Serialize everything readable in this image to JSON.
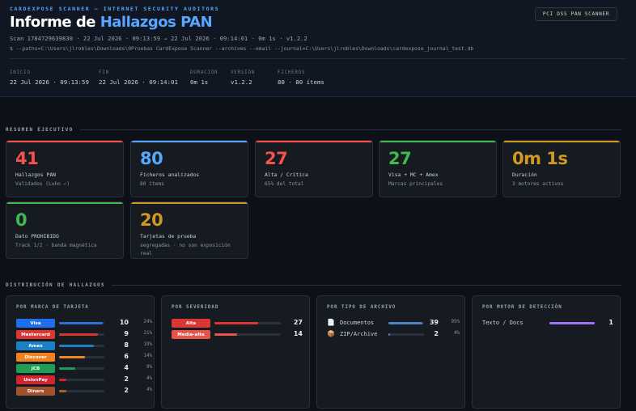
{
  "header": {
    "brand": "CARDEXPOSE SCANNER — INTERNET SECURITY AUDITORS",
    "title_prefix": "Informe de ",
    "title_accent": "Hallazgos PAN",
    "scan_line": "Scan 1784729639830  ·  22 Jul 2026 · 09:13:59 → 22 Jul 2026 · 09:14:01  ·  0m 1s  ·  v1.2.2",
    "command": "$ --paths=C:\\Users\\jlrobles\\Downloads\\0Pruebas CardExpose Scanner --archives --email --journal=C:\\Users\\jlrobles\\Downloads\\cardexpose_journal_test.db",
    "badge": "PCI DSS PAN SCANNER",
    "meta": [
      {
        "key": "INICIO",
        "value": "22 Jul 2026 · 09:13:59"
      },
      {
        "key": "FIN",
        "value": "22 Jul 2026 · 09:14:01"
      },
      {
        "key": "DURACIÓN",
        "value": "0m 1s"
      },
      {
        "key": "VERSIÓN",
        "value": "v1.2.2"
      },
      {
        "key": "FICHEROS",
        "value": "80 · 80 ítems"
      }
    ]
  },
  "sections": {
    "summary": "RESUMEN EJECUTIVO",
    "distribution": "DISTRIBUCIÓN DE HALLAZGOS"
  },
  "kpis": [
    {
      "value": "41",
      "label": "Hallazgos PAN",
      "sub": "Validados (Luhn ✓)",
      "color": "#f85149",
      "bar": "#f85149"
    },
    {
      "value": "80",
      "label": "Ficheros analizados",
      "sub": "80 ítems",
      "color": "#58a6ff",
      "bar": "#58a6ff"
    },
    {
      "value": "27",
      "label": "Alta / Crítica",
      "sub": "65% del total",
      "color": "#f85149",
      "bar": "#f85149"
    },
    {
      "value": "27",
      "label": "Visa + MC + Amex",
      "sub": "Marcas principales",
      "color": "#3fb950",
      "bar": "#3fb950"
    },
    {
      "value": "0m 1s",
      "label": "Duración",
      "sub": "3 motores activos",
      "color": "#d29922",
      "bar": "#d29922"
    },
    {
      "value": "0",
      "label": "Dato PROHIBIDO",
      "sub": "Track 1/2 · banda magnética",
      "color": "#3fb950",
      "bar": "#3fb950"
    },
    {
      "value": "20",
      "label": "Tarjetas de prueba",
      "sub": "segregadas · no son exposición real",
      "color": "#d29922",
      "bar": "#d29922"
    }
  ],
  "panels": {
    "brand": {
      "title": "POR MARCA DE TARJETA",
      "rows": [
        {
          "name": "Visa",
          "count": "10",
          "pct": "24%",
          "frac": 0.24,
          "color": "#1f6feb",
          "bar": "#2f6fd8"
        },
        {
          "name": "Mastercard",
          "count": "9",
          "pct": "21%",
          "frac": 0.21,
          "color": "#da3633",
          "bar": "#da3633"
        },
        {
          "name": "Amex",
          "count": "8",
          "pct": "19%",
          "frac": 0.19,
          "color": "#1b80c4",
          "bar": "#1b80c4"
        },
        {
          "name": "Discover",
          "count": "6",
          "pct": "14%",
          "frac": 0.14,
          "color": "#f0821f",
          "bar": "#f0821f"
        },
        {
          "name": "JCB",
          "count": "4",
          "pct": "9%",
          "frac": 0.09,
          "color": "#1f9d55",
          "bar": "#1f9d55"
        },
        {
          "name": "UnionPay",
          "count": "2",
          "pct": "4%",
          "frac": 0.04,
          "color": "#d1242f",
          "bar": "#d1242f"
        },
        {
          "name": "Diners",
          "count": "2",
          "pct": "4%",
          "frac": 0.04,
          "color": "#a0522d",
          "bar": "#b35c24"
        }
      ]
    },
    "severity": {
      "title": "POR SEVERIDAD",
      "rows": [
        {
          "name": "Alta",
          "count": "27",
          "frac": 0.66,
          "color": "#da3633",
          "bar": "#da3633"
        },
        {
          "name": "Media-alta",
          "count": "14",
          "frac": 0.34,
          "color": "#e5534b",
          "bar": "#e5534b"
        }
      ]
    },
    "filetype": {
      "title": "POR TIPO DE ARCHIVO",
      "rows": [
        {
          "icon": "📄",
          "icon_name": "document-icon",
          "name": "Documentos",
          "count": "39",
          "pct": "95%",
          "frac": 0.95,
          "bar": "#4f82c8"
        },
        {
          "icon": "📦",
          "icon_name": "archive-icon",
          "name": "ZIP/Archive",
          "count": "2",
          "pct": "4%",
          "frac": 0.04,
          "bar": "#4f82c8"
        }
      ]
    },
    "engine": {
      "title": "POR MOTOR DE DETECCIÓN",
      "rows": [
        {
          "name": "Texto / Docs",
          "count": "1",
          "frac": 1.0,
          "bar": "#a371f7"
        }
      ]
    }
  }
}
